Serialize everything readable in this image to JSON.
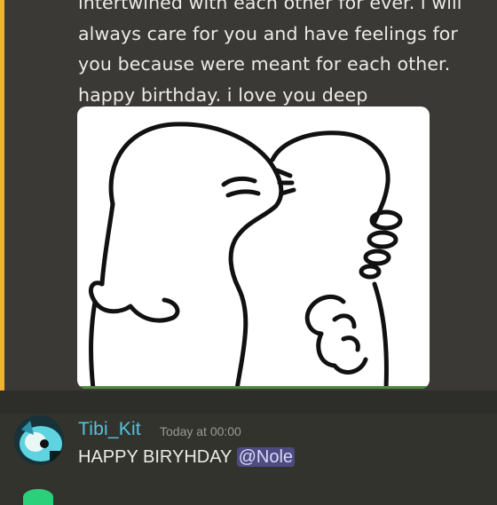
{
  "colors": {
    "mention_highlight": "#f0b232",
    "author_name": "#58c2dc",
    "mention_pill": "#4e4b82"
  },
  "messages": [
    {
      "lines": [
        "intertwined with each other for ever. i will",
        "always care for you and have feelings for",
        "you because were meant for each other.",
        "happy birthday. i love you deep"
      ],
      "attachment": {
        "type": "image",
        "icon": "hug-drawing"
      }
    },
    {
      "author": "Tibi_Kit",
      "timestamp": "Today at 00:00",
      "text": "HAPPY BIRYHDAY",
      "mention": "@Nole"
    }
  ]
}
